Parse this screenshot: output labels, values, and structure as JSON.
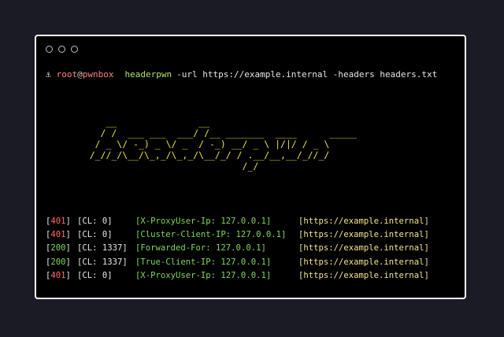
{
  "window_controls": [
    "circle-icon",
    "circle-icon",
    "circle-icon"
  ],
  "prompt": {
    "icon": "anchor-icon",
    "user": "root",
    "at": "@",
    "host": "pwnbox",
    "command": "headerpwn",
    "args": "-url https://example.internal -headers headers.txt"
  },
  "banner": [
    "       __               __",
    "      / /  ___ ___  ___/ /__ _______  ____      _____",
    "     / _ \\/ -_) _ \\/ _  / -_) __/ _ \\ |/|/ / _ \\",
    "    /_//_/\\__/\\_,_/\\_,_/\\__/_/ / .__/__,__/_//_/",
    "                                /_/"
  ],
  "colors": {
    "background": "#1b1b26",
    "terminal": "#000000",
    "status_error": "#ff6b6b",
    "status_ok": "#7ed957",
    "header": "#7ed957",
    "url": "#f2e58a",
    "banner": "#e8e03a"
  },
  "results": [
    {
      "status": "401",
      "cl": "[CL: 0]",
      "header": "[X-ProxyUser-Ip: 127.0.0.1]",
      "url": "[https://example.internal]"
    },
    {
      "status": "401",
      "cl": "[CL: 0]",
      "header": "[Cluster-Client-IP: 127.0.0.1]",
      "url": "[https://example.internal]"
    },
    {
      "status": "200",
      "cl": "[CL: 1337]",
      "header": "[Forwarded-For: 127.0.0.1]",
      "url": "[https://example.internal]"
    },
    {
      "status": "200",
      "cl": "[CL: 1337]",
      "header": "[True-Client-IP: 127.0.0.1]",
      "url": "[https://example.internal]"
    },
    {
      "status": "401",
      "cl": "[CL: 0]",
      "header": "[X-ProxyUser-Ip: 127.0.0.1]",
      "url": "[https://example.internal]"
    }
  ]
}
